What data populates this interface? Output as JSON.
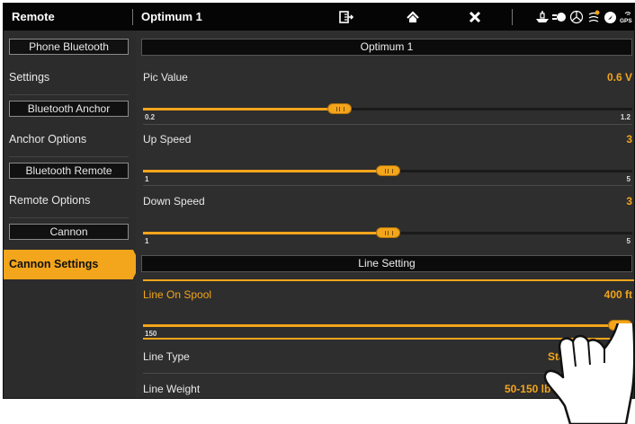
{
  "topbar": {
    "left_title": "Remote",
    "title": "Optimum 1",
    "icons": [
      "export-icon",
      "home-icon",
      "close-icon"
    ],
    "status_icons": [
      "boat-icon",
      "trolling-motor-icon",
      "steering-icon",
      "waypoint-icon",
      "compass-icon",
      "gps-icon"
    ],
    "gps_label": "GPS"
  },
  "sidebar": {
    "phone_bluetooth": "Phone Bluetooth",
    "settings": "Settings",
    "bluetooth_anchor": "Bluetooth Anchor",
    "anchor_options": "Anchor Options",
    "bluetooth_remote": "Bluetooth Remote",
    "remote_options": "Remote Options",
    "cannon": "Cannon",
    "cannon_settings": "Cannon Settings"
  },
  "main": {
    "section1_title": "Optimum 1",
    "pic_value": {
      "label": "Pic Value",
      "value": "0.6 V",
      "min": "0.2",
      "max": "1.2",
      "level": 0.4
    },
    "up_speed": {
      "label": "Up Speed",
      "value": "3",
      "min": "1",
      "max": "5",
      "level": 0.5
    },
    "down_speed": {
      "label": "Down Speed",
      "value": "3",
      "min": "1",
      "max": "5",
      "level": 0.5
    },
    "section2_title": "Line Setting",
    "line_on_spool": {
      "label": "Line On Spool",
      "value": "400 ft",
      "min": "150",
      "max": "0",
      "level": 1.0
    },
    "line_type": {
      "label": "Line Type",
      "value": "Stai"
    },
    "line_weight": {
      "label": "Line Weight",
      "value": "50-150 lb (22"
    }
  },
  "colors": {
    "accent": "#f3a51c",
    "bar": "#050505",
    "panel": "#2e2e2e"
  }
}
